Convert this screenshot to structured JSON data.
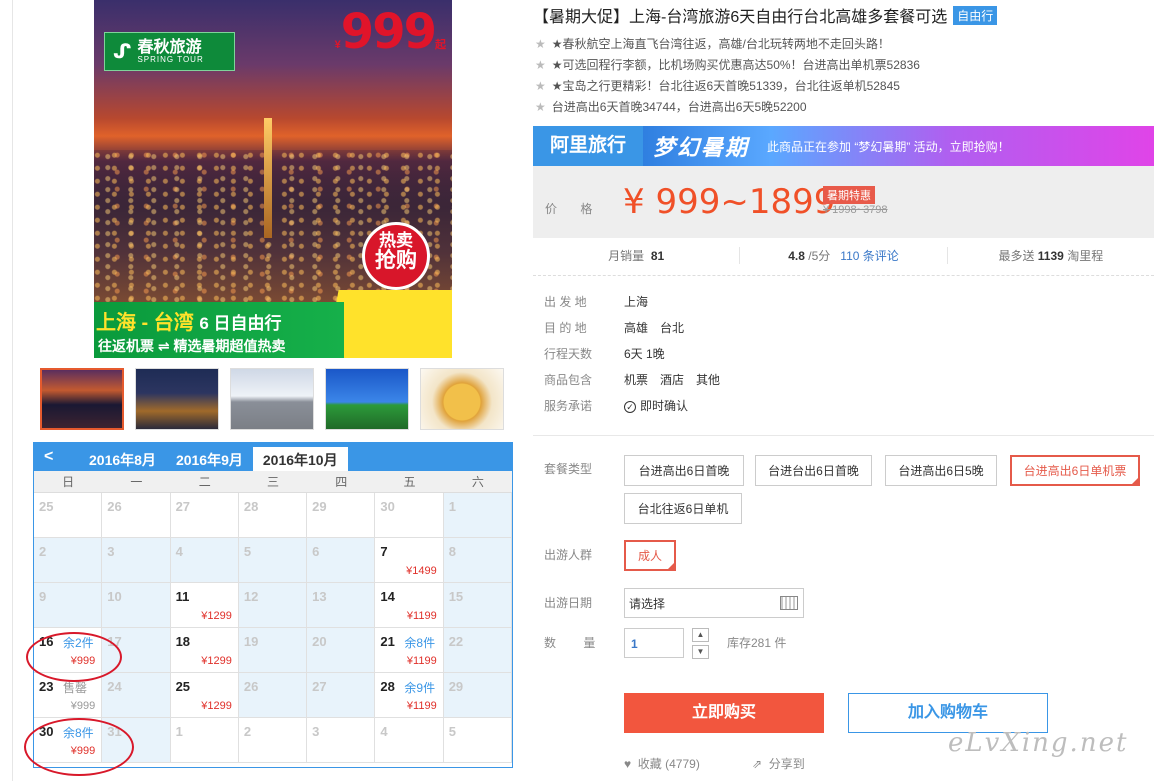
{
  "image": {
    "logo_cn": "春秋旅游",
    "logo_en": "SPRING TOUR",
    "hot_line1": "热卖",
    "hot_line2": "抢购",
    "route_a": "上海 - 台湾",
    "route_b": "6 日自由行",
    "sub": "往返机票 ⇌ 精选暑期超值热卖",
    "yen": "¥",
    "price": "999",
    "qi": "起"
  },
  "thumbnails": [
    "thumb-1",
    "thumb-2",
    "thumb-3",
    "thumb-4",
    "thumb-5"
  ],
  "calendar": {
    "prev": "<",
    "months": [
      "2016年8月",
      "2016年9月",
      "2016年10月"
    ],
    "active_month": 2,
    "weekdays": [
      "日",
      "一",
      "二",
      "三",
      "四",
      "五",
      "六"
    ],
    "cells": [
      {
        "d": "25",
        "bg": "white"
      },
      {
        "d": "26",
        "bg": "white"
      },
      {
        "d": "27",
        "bg": "white"
      },
      {
        "d": "28",
        "bg": "white"
      },
      {
        "d": "29",
        "bg": "white"
      },
      {
        "d": "30",
        "bg": "white"
      },
      {
        "d": "1",
        "bg": "blue"
      },
      {
        "d": "2",
        "bg": "blue"
      },
      {
        "d": "3",
        "bg": "blue"
      },
      {
        "d": "4",
        "bg": "blue"
      },
      {
        "d": "5",
        "bg": "blue"
      },
      {
        "d": "6",
        "bg": "blue"
      },
      {
        "d": "7",
        "bg": "white",
        "avail": true,
        "p": "¥1499"
      },
      {
        "d": "8",
        "bg": "blue"
      },
      {
        "d": "9",
        "bg": "blue"
      },
      {
        "d": "10",
        "bg": "blue"
      },
      {
        "d": "11",
        "bg": "white",
        "avail": true,
        "p": "¥1299"
      },
      {
        "d": "12",
        "bg": "blue"
      },
      {
        "d": "13",
        "bg": "blue"
      },
      {
        "d": "14",
        "bg": "white",
        "avail": true,
        "p": "¥1199"
      },
      {
        "d": "15",
        "bg": "blue"
      },
      {
        "d": "16",
        "bg": "white",
        "avail": true,
        "s": "余2件",
        "p": "¥999"
      },
      {
        "d": "17",
        "bg": "blue"
      },
      {
        "d": "18",
        "bg": "white",
        "avail": true,
        "p": "¥1299"
      },
      {
        "d": "19",
        "bg": "blue"
      },
      {
        "d": "20",
        "bg": "blue"
      },
      {
        "d": "21",
        "bg": "white",
        "avail": true,
        "s": "余8件",
        "p": "¥1199"
      },
      {
        "d": "22",
        "bg": "blue"
      },
      {
        "d": "23",
        "bg": "white",
        "avail": true,
        "soldout": true,
        "s": "售罄",
        "p": "¥999"
      },
      {
        "d": "24",
        "bg": "blue"
      },
      {
        "d": "25",
        "bg": "white",
        "avail": true,
        "p": "¥1299"
      },
      {
        "d": "26",
        "bg": "blue"
      },
      {
        "d": "27",
        "bg": "blue"
      },
      {
        "d": "28",
        "bg": "white",
        "avail": true,
        "s": "余9件",
        "p": "¥1199"
      },
      {
        "d": "29",
        "bg": "blue"
      },
      {
        "d": "30",
        "bg": "white",
        "avail": true,
        "s": "余8件",
        "p": "¥999"
      },
      {
        "d": "31",
        "bg": "blue"
      },
      {
        "d": "1",
        "bg": "white"
      },
      {
        "d": "2",
        "bg": "white"
      },
      {
        "d": "3",
        "bg": "white"
      },
      {
        "d": "4",
        "bg": "white"
      },
      {
        "d": "5",
        "bg": "white"
      }
    ]
  },
  "product": {
    "title": "【暑期大促】上海-台湾旅游6天自由行台北高雄多套餐可选",
    "tag": "自由行",
    "bullets": [
      "★春秋航空上海直飞台湾往返，高雄/台北玩转两地不走回头路！",
      "★可选回程行李额，比机场购买优惠高达50%！台进高出单机票52836",
      "★宝岛之行更精彩！台北往返6天首晚51339，台北往返单机52845",
      "台进高出6天首晚34744，台进高出6天5晚52200"
    ],
    "bullet_star": "★"
  },
  "ali": {
    "brand": "阿里旅行",
    "campaign": "梦幻暑期",
    "note": "此商品正在参加 “梦幻暑期” 活动，立即抢购！"
  },
  "price": {
    "label": "价 格",
    "range": "¥ 999~1899",
    "promo": "暑期特惠",
    "original": "¥ 1998~3798"
  },
  "stats": {
    "sales_label": "月销量",
    "sales": "81",
    "rating": "4.8",
    "rating_suffix": "/5分",
    "reviews": "110 条评论",
    "points_label": "最多送",
    "points": "1139",
    "points_suffix": "淘里程"
  },
  "info": [
    {
      "k": "出 发 地",
      "v": [
        "上海"
      ]
    },
    {
      "k": "目 的 地",
      "v": [
        "高雄",
        "台北"
      ]
    },
    {
      "k": "行程天数",
      "v": [
        "6天 1晚"
      ]
    },
    {
      "k": "商品包含",
      "v": [
        "机票",
        "酒店",
        "其他"
      ]
    },
    {
      "k": "服务承诺",
      "v": [
        "即时确认"
      ]
    }
  ],
  "options": {
    "package_label": "套餐类型",
    "packages": [
      "台进高出6日首晚",
      "台进台出6日首晚",
      "台进高出6日5晚",
      "台进高出6日单机票",
      "台北往返6日单机"
    ],
    "selected_package": 3,
    "people_label": "出游人群",
    "people": [
      "成人"
    ],
    "date_label": "出游日期",
    "date_placeholder": "请选择",
    "qty_label": "数 量",
    "qty": "1",
    "up": "▲",
    "down": "▼",
    "stock": "库存281 件"
  },
  "actions": {
    "buy": "立即购买",
    "cart": "加入购物车",
    "fav": "收藏 (4779)",
    "share": "分享到"
  },
  "watermark": "eLvXing.net"
}
